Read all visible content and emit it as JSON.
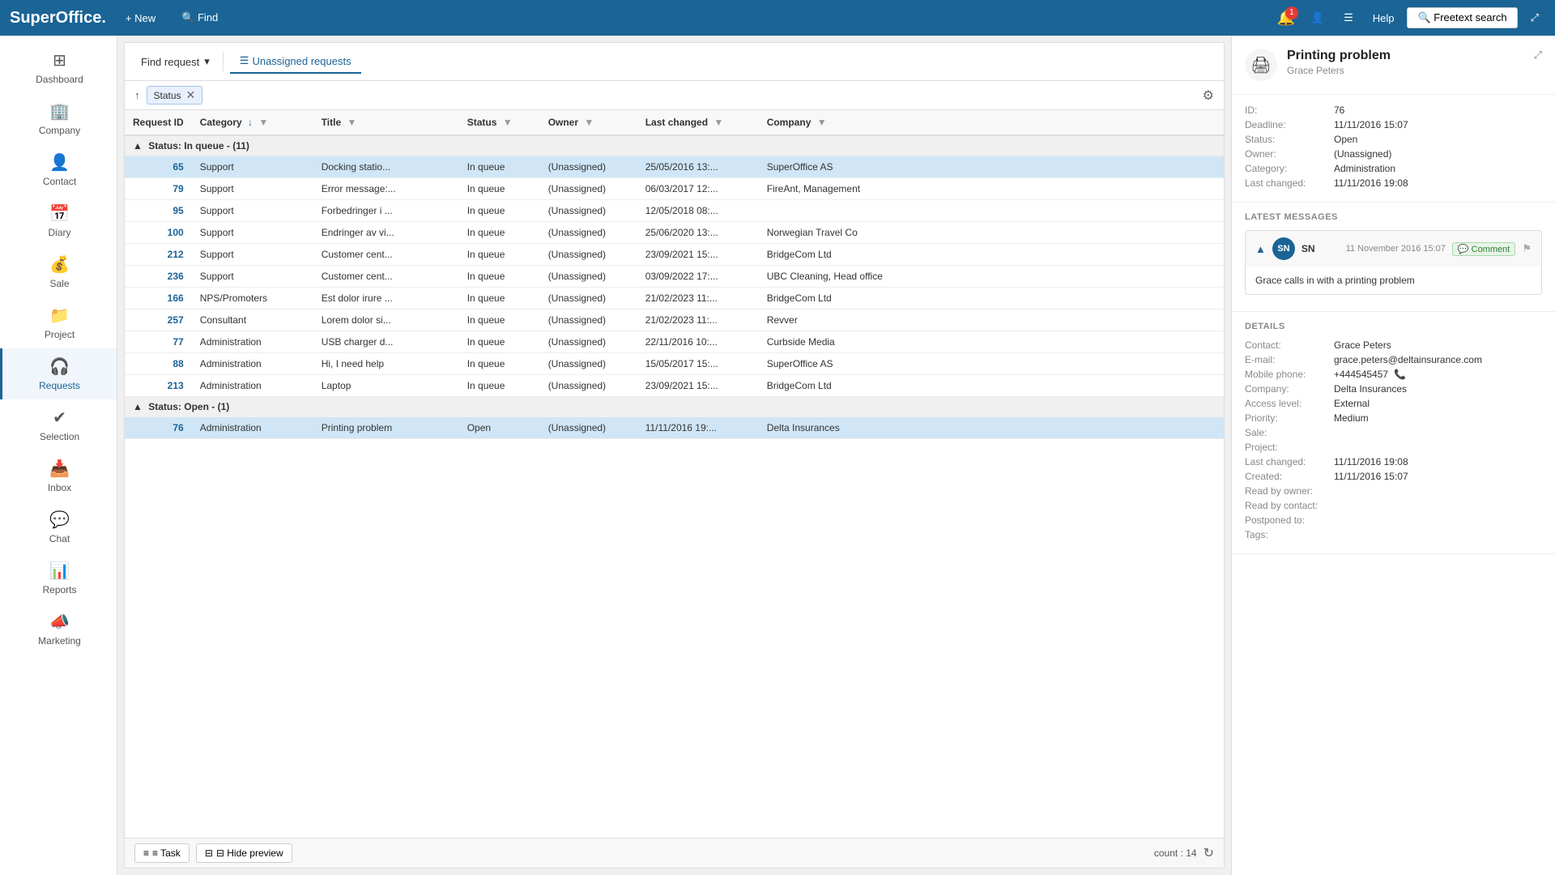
{
  "app": {
    "logo": "SuperOffice.",
    "nav_new": "+ New",
    "nav_find": "🔍 Find",
    "notifications_count": "1",
    "help_label": "Help",
    "freetext_search": "🔍 Freetext search"
  },
  "sidebar": {
    "items": [
      {
        "id": "dashboard",
        "label": "Dashboard",
        "icon": "⊞"
      },
      {
        "id": "company",
        "label": "Company",
        "icon": "🏢"
      },
      {
        "id": "contact",
        "label": "Contact",
        "icon": "👤"
      },
      {
        "id": "diary",
        "label": "Diary",
        "icon": "📅"
      },
      {
        "id": "sale",
        "label": "Sale",
        "icon": "💰"
      },
      {
        "id": "project",
        "label": "Project",
        "icon": "📁"
      },
      {
        "id": "requests",
        "label": "Requests",
        "icon": "🎧",
        "active": true
      },
      {
        "id": "selection",
        "label": "Selection",
        "icon": "✔️"
      },
      {
        "id": "inbox",
        "label": "Inbox",
        "icon": "📥"
      },
      {
        "id": "chat",
        "label": "Chat",
        "icon": "💬"
      },
      {
        "id": "reports",
        "label": "Reports",
        "icon": "📊"
      },
      {
        "id": "marketing",
        "label": "Marketing",
        "icon": "📣"
      }
    ]
  },
  "toolbar": {
    "find_request": "Find request",
    "view_label": "Unassigned requests"
  },
  "filter": {
    "label": "Status",
    "settings_icon": "⚙"
  },
  "columns": [
    {
      "id": "request_id",
      "label": "Request ID"
    },
    {
      "id": "category",
      "label": "Category",
      "sorted": true
    },
    {
      "id": "title",
      "label": "Title"
    },
    {
      "id": "status",
      "label": "Status"
    },
    {
      "id": "owner",
      "label": "Owner"
    },
    {
      "id": "last_changed",
      "label": "Last changed"
    },
    {
      "id": "company",
      "label": "Company"
    }
  ],
  "group_in_queue": {
    "label": "Status: In queue - (11)"
  },
  "rows_in_queue": [
    {
      "id": 65,
      "category": "Support",
      "title": "Docking statio...",
      "status": "In queue",
      "owner": "(Unassigned)",
      "last_changed": "25/05/2016 13:...",
      "company": "SuperOffice AS",
      "selected": true
    },
    {
      "id": 79,
      "category": "Support",
      "title": "Error message:...",
      "status": "In queue",
      "owner": "(Unassigned)",
      "last_changed": "06/03/2017 12:...",
      "company": "FireAnt, Management",
      "selected": false
    },
    {
      "id": 95,
      "category": "Support",
      "title": "Forbedringer i ...",
      "status": "In queue",
      "owner": "(Unassigned)",
      "last_changed": "12/05/2018 08:...",
      "company": "",
      "selected": false
    },
    {
      "id": 100,
      "category": "Support",
      "title": "Endringer av vi...",
      "status": "In queue",
      "owner": "(Unassigned)",
      "last_changed": "25/06/2020 13:...",
      "company": "Norwegian Travel Co",
      "selected": false
    },
    {
      "id": 212,
      "category": "Support",
      "title": "Customer cent...",
      "status": "In queue",
      "owner": "(Unassigned)",
      "last_changed": "23/09/2021 15:...",
      "company": "BridgeCom Ltd",
      "selected": false
    },
    {
      "id": 236,
      "category": "Support",
      "title": "Customer cent...",
      "status": "In queue",
      "owner": "(Unassigned)",
      "last_changed": "03/09/2022 17:...",
      "company": "UBC Cleaning, Head office",
      "selected": false
    },
    {
      "id": 166,
      "category": "NPS/Promoters",
      "title": "Est dolor irure ...",
      "status": "In queue",
      "owner": "(Unassigned)",
      "last_changed": "21/02/2023 11:...",
      "company": "BridgeCom Ltd",
      "selected": false
    },
    {
      "id": 257,
      "category": "Consultant",
      "title": "Lorem dolor si...",
      "status": "In queue",
      "owner": "(Unassigned)",
      "last_changed": "21/02/2023 11:...",
      "company": "Revver",
      "selected": false
    },
    {
      "id": 77,
      "category": "Administration",
      "title": "USB charger d...",
      "status": "In queue",
      "owner": "(Unassigned)",
      "last_changed": "22/11/2016 10:...",
      "company": "Curbside Media",
      "selected": false
    },
    {
      "id": 88,
      "category": "Administration",
      "title": "Hi, I need help",
      "status": "In queue",
      "owner": "(Unassigned)",
      "last_changed": "15/05/2017 15:...",
      "company": "SuperOffice AS",
      "selected": false
    },
    {
      "id": 213,
      "category": "Administration",
      "title": "Laptop",
      "status": "In queue",
      "owner": "(Unassigned)",
      "last_changed": "23/09/2021 15:...",
      "company": "BridgeCom Ltd",
      "selected": false
    }
  ],
  "group_open": {
    "label": "Status: Open - (1)"
  },
  "rows_open": [
    {
      "id": 76,
      "category": "Administration",
      "title": "Printing problem",
      "status": "Open",
      "owner": "(Unassigned)",
      "last_changed": "11/11/2016 19:...",
      "company": "Delta Insurances",
      "selected": true
    }
  ],
  "bottom_bar": {
    "task_label": "≡ Task",
    "hide_preview_label": "⊟ Hide preview",
    "count_label": "count : 14",
    "refresh_icon": "↻"
  },
  "preview": {
    "icon": "🖨",
    "title": "Printing problem",
    "contact": "Grace Peters",
    "id": "76",
    "deadline": "11/11/2016 15:07",
    "status": "Open",
    "owner": "(Unassigned)",
    "category": "Administration",
    "last_changed": "11/11/2016 19:08",
    "latest_messages_title": "LATEST MESSAGES",
    "message": {
      "avatar": "SN",
      "sender": "SN",
      "date": "11 November 2016 15:07",
      "tag": "Comment",
      "body": "Grace calls in with a printing problem"
    },
    "details_title": "DETAILS",
    "details": {
      "contact": "Grace Peters",
      "email": "grace.peters@deltainsurance.com",
      "mobile_phone": "+444545457",
      "company": "Delta Insurances",
      "access_level": "External",
      "priority": "Medium",
      "sale": "",
      "project": "",
      "last_changed": "11/11/2016 19:08",
      "created": "11/11/2016 15:07",
      "read_by_owner": "",
      "read_by_contact": "",
      "postponed_to": "",
      "tags": ""
    }
  }
}
